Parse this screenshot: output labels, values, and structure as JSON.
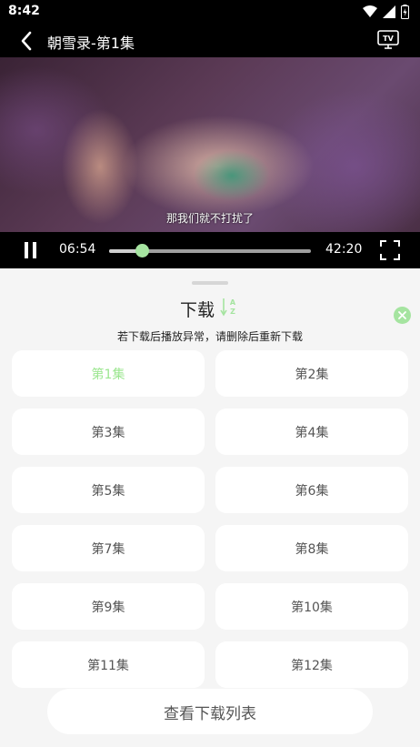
{
  "status_bar": {
    "time": "8:42",
    "icons": [
      "wifi-icon",
      "signal-icon",
      "battery-icon"
    ]
  },
  "header": {
    "title": "朝雪录-第1集",
    "back_icon": "back-arrow-icon",
    "tv_icon": "tv-cast-icon",
    "tv_label": "TV"
  },
  "player": {
    "subtitle": "那我们就不打扰了",
    "current_time": "06:54",
    "total_time": "42:20",
    "progress": 0.163,
    "accent_color": "#a5e4a0"
  },
  "sheet": {
    "title": "下载",
    "sort_icon": "sort-az-icon",
    "sort_letters": [
      "A",
      "Z"
    ],
    "close_icon": "close-icon",
    "notice": "若下载后播放异常，请删除后重新下载",
    "episodes": [
      {
        "label": "第1集",
        "active": true
      },
      {
        "label": "第2集",
        "active": false
      },
      {
        "label": "第3集",
        "active": false
      },
      {
        "label": "第4集",
        "active": false
      },
      {
        "label": "第5集",
        "active": false
      },
      {
        "label": "第6集",
        "active": false
      },
      {
        "label": "第7集",
        "active": false
      },
      {
        "label": "第8集",
        "active": false
      },
      {
        "label": "第9集",
        "active": false
      },
      {
        "label": "第10集",
        "active": false
      },
      {
        "label": "第11集",
        "active": false
      },
      {
        "label": "第12集",
        "active": false
      }
    ],
    "download_list_label": "查看下载列表"
  }
}
